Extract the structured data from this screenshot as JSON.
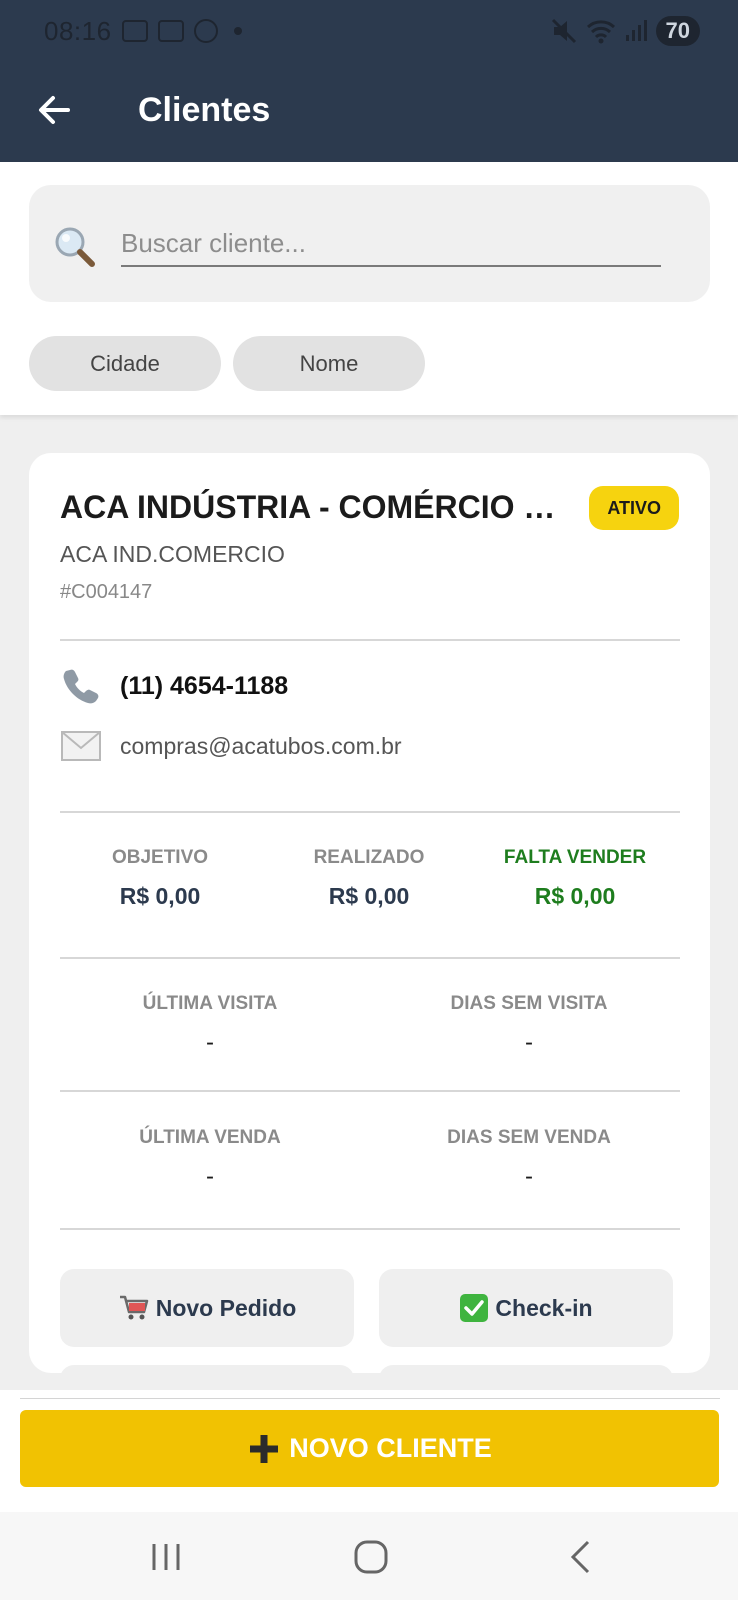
{
  "status_bar": {
    "time": "08:16",
    "battery": "70"
  },
  "header": {
    "title": "Clientes"
  },
  "search": {
    "placeholder": "Buscar cliente...",
    "value": ""
  },
  "filters": [
    {
      "label": "Cidade"
    },
    {
      "label": "Nome"
    }
  ],
  "client": {
    "name": "ACA INDÚSTRIA - COMÉRCIO E...",
    "status": "ATIVO",
    "trade_name": "ACA IND.COMERCIO",
    "code": "#C004147",
    "phone": "(11) 4654-1188",
    "email": "compras@acatubos.com.br",
    "metrics": [
      {
        "label": "OBJETIVO",
        "value": "R$ 0,00"
      },
      {
        "label": "REALIZADO",
        "value": "R$ 0,00"
      },
      {
        "label": "FALTA VENDER",
        "value": "R$ 0,00"
      }
    ],
    "visit": {
      "last_label": "ÚLTIMA VISITA",
      "last_value": "-",
      "days_label": "DIAS SEM VISITA",
      "days_value": "-"
    },
    "sale": {
      "last_label": "ÚLTIMA VENDA",
      "last_value": "-",
      "days_label": "DIAS SEM VENDA",
      "days_value": "-"
    },
    "actions": [
      {
        "label": "Novo Pedido",
        "icon": "cart-icon"
      },
      {
        "label": "Check-in",
        "icon": "check-mark-icon"
      }
    ]
  },
  "new_client_button": {
    "label": "NOVO CLIENTE",
    "icon": "plus-icon"
  },
  "colors": {
    "header": "#2c3a4e",
    "accent": "#f1c202",
    "badge": "#f6d30f",
    "positive": "#1e7d1e"
  }
}
